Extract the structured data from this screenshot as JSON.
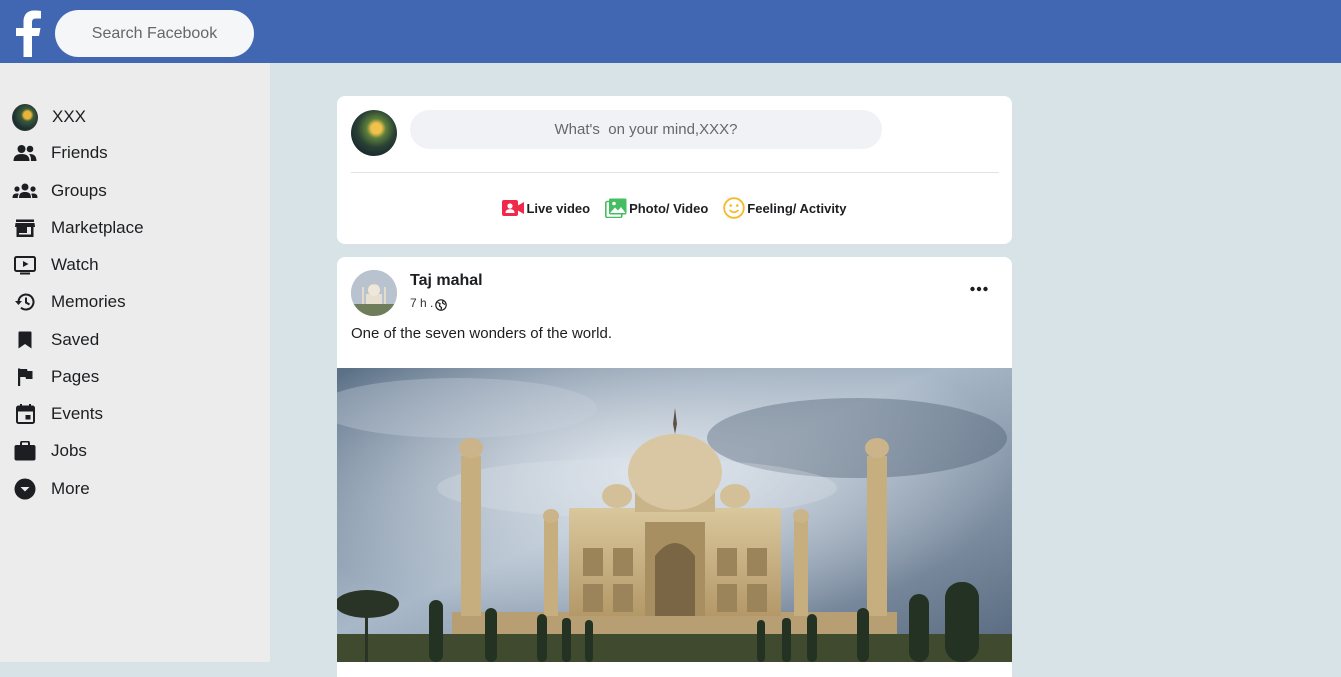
{
  "search": {
    "placeholder": "Search Facebook"
  },
  "sidebar": {
    "items": [
      {
        "label": "XXX",
        "icon": "profile-avatar"
      },
      {
        "label": "Friends",
        "icon": "friends-icon"
      },
      {
        "label": "Groups",
        "icon": "groups-icon"
      },
      {
        "label": "Marketplace",
        "icon": "marketplace-icon"
      },
      {
        "label": "Watch",
        "icon": "watch-icon"
      },
      {
        "label": "Memories",
        "icon": "memories-icon"
      },
      {
        "label": "Saved",
        "icon": "saved-icon"
      },
      {
        "label": "Pages",
        "icon": "pages-icon"
      },
      {
        "label": "Events",
        "icon": "events-icon"
      },
      {
        "label": "Jobs",
        "icon": "jobs-icon"
      },
      {
        "label": "More",
        "icon": "more-icon"
      }
    ]
  },
  "composer": {
    "placeholder": "What's  on your mind,XXX?",
    "actions": [
      {
        "label": "Live video",
        "icon": "live-video-icon",
        "color": "#f02849"
      },
      {
        "label": "Photo/ Video",
        "icon": "photo-video-icon",
        "color": "#45bd62"
      },
      {
        "label": "Feeling/ Activity",
        "icon": "feeling-icon",
        "color": "#f7b928"
      }
    ]
  },
  "post": {
    "author": "Taj mahal",
    "time": "7 h .",
    "text": "One of the seven wonders of the world."
  },
  "colors": {
    "brand": "#4267b2",
    "sidebar_bg": "#ececec",
    "feed_bg": "#d8e3e8"
  }
}
